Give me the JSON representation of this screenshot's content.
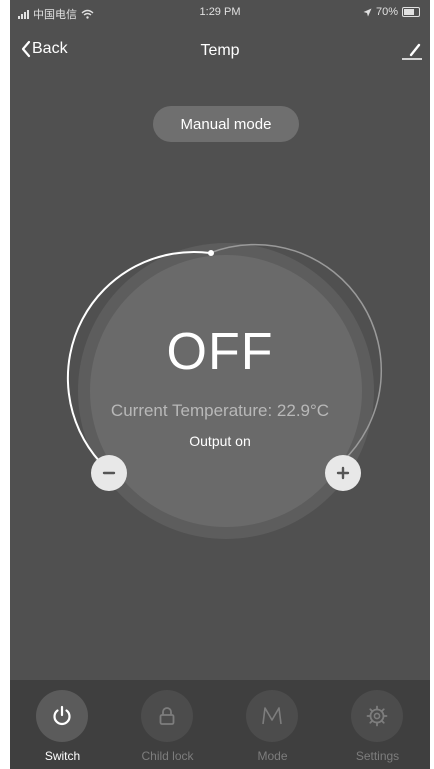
{
  "status_bar": {
    "carrier": "中国电信",
    "time": "1:29 PM",
    "battery": "70%"
  },
  "nav": {
    "back_label": "Back",
    "title": "Temp"
  },
  "mode_pill": {
    "label": "Manual mode"
  },
  "dial": {
    "status": "OFF",
    "current_temperature": "Current Temperature: 22.9°C",
    "output_status": "Output on"
  },
  "tabs": [
    {
      "label": "Switch",
      "icon": "power-icon",
      "active": true
    },
    {
      "label": "Child lock",
      "icon": "lock-icon",
      "active": false
    },
    {
      "label": "Mode",
      "icon": "mode-m-icon",
      "active": false
    },
    {
      "label": "Settings",
      "icon": "gear-icon",
      "active": false
    }
  ],
  "colors": {
    "background": "#505050",
    "tab_bar": "#3f3f3f",
    "dial": "#6a6a6a",
    "accent": "#ffffff"
  }
}
